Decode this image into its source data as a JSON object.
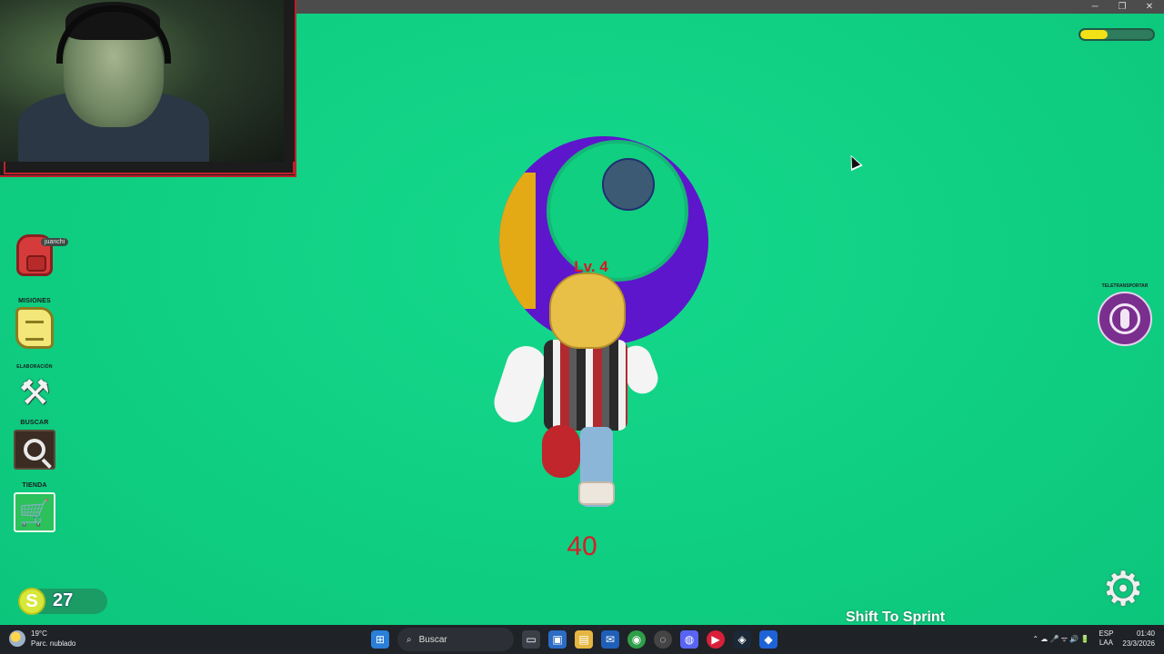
{
  "window": {
    "minimize": "─",
    "restore": "❐",
    "close": "✕"
  },
  "hud": {
    "health_fraction": 0.38,
    "level_label": "Lv. 4",
    "speed_value": "40",
    "sprint_hint": "Shift To Sprint",
    "coins": {
      "symbol": "S",
      "count": "27"
    },
    "teleport_label": "TELETRANSPORTAR"
  },
  "menu": {
    "backpack_label": "Mochila",
    "player_chip": "juanchi",
    "missions_label": "MISIONES",
    "crafting_label": "ELABORACIÓN",
    "search_label": "BUSCAR",
    "shop_label": "TIENDA",
    "tools_glyph": "⚒",
    "cart_glyph": "🛒"
  },
  "settings_glyph": "⚙",
  "taskbar": {
    "weather_temp": "19°C",
    "weather_desc": "Parc. nublado",
    "search_placeholder": "Buscar",
    "lang_top": "ESP",
    "lang_bottom": "LAA",
    "time": "01:40",
    "date": "23/3/2026",
    "tray_glyphs": "⌃  ☁  🎤  ᯤ  🔊  🔋"
  }
}
